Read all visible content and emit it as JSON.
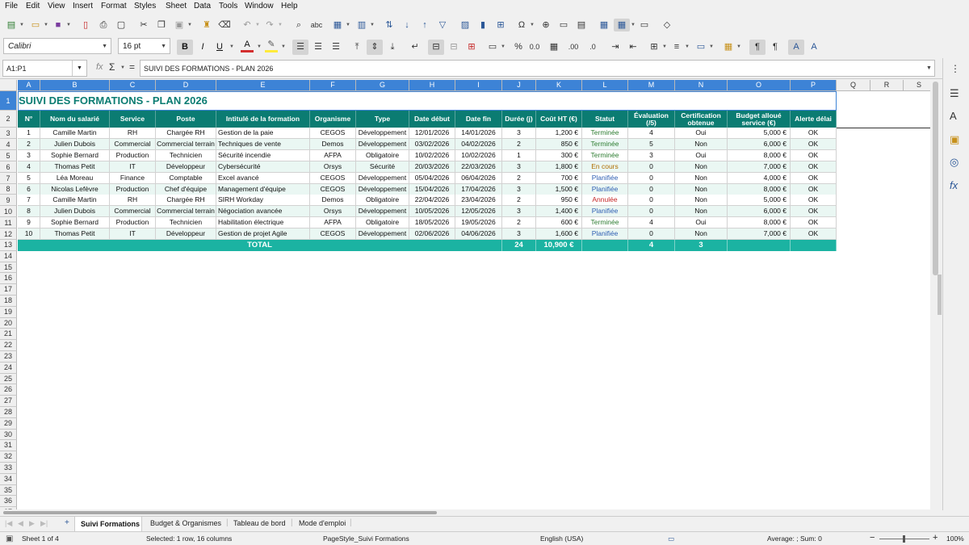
{
  "menu": [
    "File",
    "Edit",
    "View",
    "Insert",
    "Format",
    "Styles",
    "Sheet",
    "Data",
    "Tools",
    "Window",
    "Help"
  ],
  "toolbar": {
    "font_name": "Calibri",
    "font_size": "16 pt",
    "bold": "B",
    "italic": "I",
    "underline": "U",
    "font_color_letter": "A",
    "percent": "%",
    "decimal_add": ".00",
    "decimal_remove": ".0"
  },
  "formula_bar": {
    "name_box": "A1:P1",
    "fx": "fx",
    "sigma": "Σ",
    "equals": "=",
    "content": "SUIVI DES FORMATIONS - PLAN 2026"
  },
  "columns": [
    "A",
    "B",
    "C",
    "D",
    "E",
    "F",
    "G",
    "H",
    "I",
    "J",
    "K",
    "L",
    "M",
    "N",
    "O",
    "P",
    "Q",
    "R",
    "S"
  ],
  "rows": [
    "1",
    "2",
    "3",
    "4",
    "5",
    "6",
    "7",
    "8",
    "9",
    "10",
    "11",
    "12",
    "13",
    "14",
    "15",
    "16",
    "17",
    "18",
    "19",
    "20",
    "21",
    "22",
    "23",
    "24",
    "25",
    "26",
    "27",
    "28",
    "29",
    "30",
    "31",
    "32",
    "33",
    "34",
    "35",
    "36",
    "37"
  ],
  "sheet": {
    "title": "SUIVI DES FORMATIONS - PLAN 2026",
    "headers": [
      "N°",
      "Nom du salarié",
      "Service",
      "Poste",
      "Intitulé de la formation",
      "Organisme",
      "Type",
      "Date début",
      "Date fin",
      "Durée (j)",
      "Coût HT (€)",
      "Statut",
      "Évaluation (/5)",
      "Certification obtenue",
      "Budget alloué service (€)",
      "Alerte délai"
    ],
    "data": [
      [
        "1",
        "Camille Martin",
        "RH",
        "Chargée RH",
        "Gestion de la paie",
        "CEGOS",
        "Développement",
        "12/01/2026",
        "14/01/2026",
        "3",
        "1,200 €",
        "Terminée",
        "4",
        "Oui",
        "5,000 €",
        "OK"
      ],
      [
        "2",
        "Julien Dubois",
        "Commercial",
        "Commercial terrain",
        "Techniques de vente",
        "Demos",
        "Développement",
        "03/02/2026",
        "04/02/2026",
        "2",
        "850 €",
        "Terminée",
        "5",
        "Non",
        "6,000 €",
        "OK"
      ],
      [
        "3",
        "Sophie Bernard",
        "Production",
        "Technicien",
        "Sécurité incendie",
        "AFPA",
        "Obligatoire",
        "10/02/2026",
        "10/02/2026",
        "1",
        "300 €",
        "Terminée",
        "3",
        "Oui",
        "8,000 €",
        "OK"
      ],
      [
        "4",
        "Thomas Petit",
        "IT",
        "Développeur",
        "Cybersécurité",
        "Orsys",
        "Sécurité",
        "20/03/2026",
        "22/03/2026",
        "3",
        "1,800 €",
        "En cours",
        "0",
        "Non",
        "7,000 €",
        "OK"
      ],
      [
        "5",
        "Léa Moreau",
        "Finance",
        "Comptable",
        "Excel avancé",
        "CEGOS",
        "Développement",
        "05/04/2026",
        "06/04/2026",
        "2",
        "700 €",
        "Planifiée",
        "0",
        "Non",
        "4,000 €",
        "OK"
      ],
      [
        "6",
        "Nicolas Lefèvre",
        "Production",
        "Chef d'équipe",
        "Management d'équipe",
        "CEGOS",
        "Développement",
        "15/04/2026",
        "17/04/2026",
        "3",
        "1,500 €",
        "Planifiée",
        "0",
        "Non",
        "8,000 €",
        "OK"
      ],
      [
        "7",
        "Camille Martin",
        "RH",
        "Chargée RH",
        "SIRH Workday",
        "Demos",
        "Obligatoire",
        "22/04/2026",
        "23/04/2026",
        "2",
        "950 €",
        "Annulée",
        "0",
        "Non",
        "5,000 €",
        "OK"
      ],
      [
        "8",
        "Julien Dubois",
        "Commercial",
        "Commercial terrain",
        "Négociation avancée",
        "Orsys",
        "Développement",
        "10/05/2026",
        "12/05/2026",
        "3",
        "1,400 €",
        "Planifiée",
        "0",
        "Non",
        "6,000 €",
        "OK"
      ],
      [
        "9",
        "Sophie Bernard",
        "Production",
        "Technicien",
        "Habilitation électrique",
        "AFPA",
        "Obligatoire",
        "18/05/2026",
        "19/05/2026",
        "2",
        "600 €",
        "Terminée",
        "4",
        "Oui",
        "8,000 €",
        "OK"
      ],
      [
        "10",
        "Thomas Petit",
        "IT",
        "Développeur",
        "Gestion de projet Agile",
        "CEGOS",
        "Développement",
        "02/06/2026",
        "04/06/2026",
        "3",
        "1,600 €",
        "Planifiée",
        "0",
        "Non",
        "7,000 €",
        "OK"
      ]
    ],
    "total": {
      "label": "TOTAL",
      "duration": "24",
      "cost": "10,900 €",
      "evaluation": "4",
      "certifications": "3"
    }
  },
  "tabs": [
    "Suivi Formations",
    "Budget & Organismes",
    "Tableau de bord",
    "Mode d'emploi"
  ],
  "status_bar": {
    "sheet": "Sheet 1 of 4",
    "selection": "Selected: 1 row, 16 columns",
    "page_style": "PageStyle_Suivi Formations",
    "language": "English (USA)",
    "sum": "Average: ; Sum: 0",
    "zoom": "100%"
  },
  "colors": {
    "header_teal": "#0b7c72",
    "total_teal": "#1bb3a2",
    "title_teal": "#0b7c72",
    "selection_blue": "#3d83d6"
  }
}
